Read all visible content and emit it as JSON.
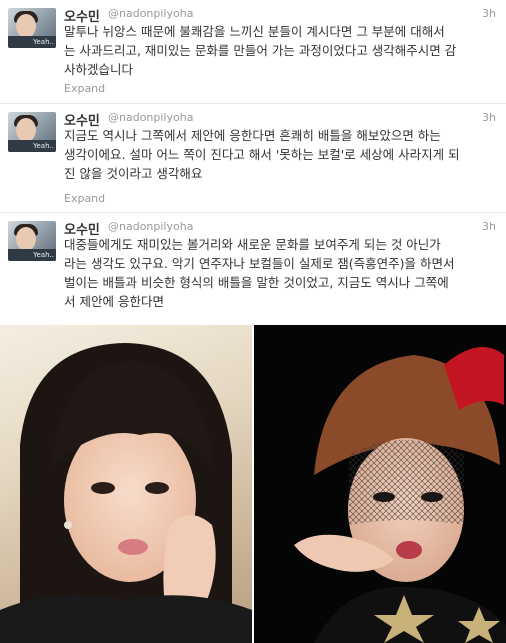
{
  "tweets": [
    {
      "name": "오수민",
      "handle": "@nadonpilyoha",
      "time": "3h",
      "text": "말투나 뉘앙스 때문에 불쾌감을 느끼신 분들이 계시다면 그 부분에 대해서\n는 사과드리고, 재미있는 문화를 만들어 가는 과정이었다고 생각해주시면 감\n사하겠습니다",
      "expand": "Expand"
    },
    {
      "name": "오수민",
      "handle": "@nadonpilyoha",
      "time": "3h",
      "text": "지금도 역시나 그쪽에서 제안에 응한다면 흔쾌히 배틀을 해보았으면 하는\n생각이에요. 설마 어느 쪽이 진다고 해서 '못하는 보컬'로 세상에 사라지게 되\n진 않을 것이라고 생각해요",
      "expand": "Expand"
    },
    {
      "name": "오수민",
      "handle": "@nadonpilyoha",
      "time": "3h",
      "text": "대중들에게도 재미있는 볼거리와 새로운 문화를 보여주게 되는 것 아닌가\n라는 생각도 있구요. 악기 연주자나 보컬들이 실제로 잼(즉흥연주)을 하면서\n벌이는 배틀과 비슷한 형식의 배틀을 말한 것이었고, 지금도 역시나 그쪽에\n서 제안에 응한다면"
    }
  ],
  "avatar_tag": "Yeah..",
  "colors": {
    "name": "#333333",
    "meta": "#9a9a9a",
    "text": "#333333",
    "divider": "#e6e6e6"
  },
  "icons": {
    "avatar": "profile-photo",
    "photo_left": "woman-selfie-photo",
    "photo_right": "woman-stage-photo"
  }
}
